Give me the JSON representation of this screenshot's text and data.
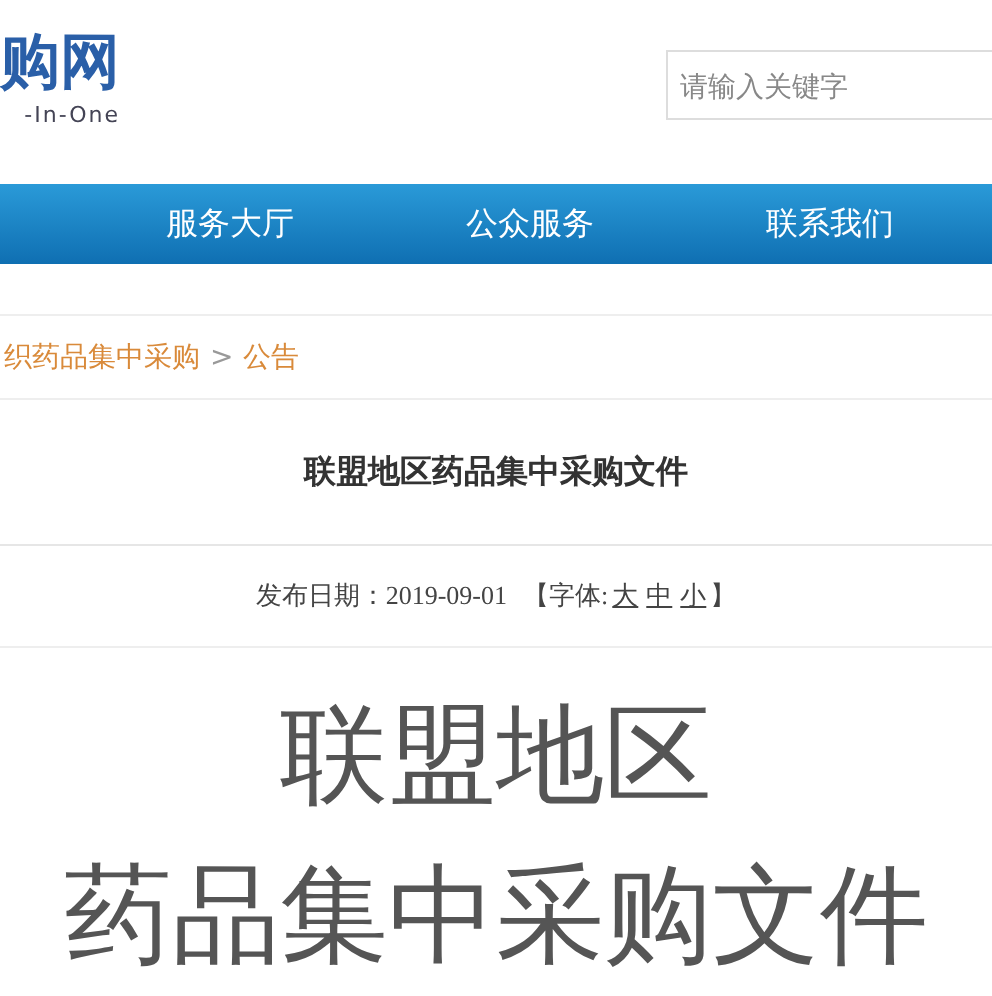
{
  "logo": {
    "title": "购网",
    "subtitle": "-In-One"
  },
  "search": {
    "placeholder": "请输入关键字"
  },
  "nav": [
    {
      "label": "服务大厅"
    },
    {
      "label": "公众服务"
    },
    {
      "label": "联系我们"
    }
  ],
  "breadcrumb": [
    {
      "label": "织药品集中采购"
    },
    {
      "label": "公告"
    }
  ],
  "breadcrumb_separator": ">",
  "article": {
    "title": "联盟地区药品集中采购文件",
    "date_label": "发布日期：2019-09-01",
    "font_size": {
      "open": "【字体:",
      "options": [
        {
          "label": "大"
        },
        {
          "label": "中"
        },
        {
          "label": "小"
        }
      ],
      "close": "】"
    },
    "body_lines": [
      "联盟地区",
      "药品集中采购文件"
    ]
  }
}
